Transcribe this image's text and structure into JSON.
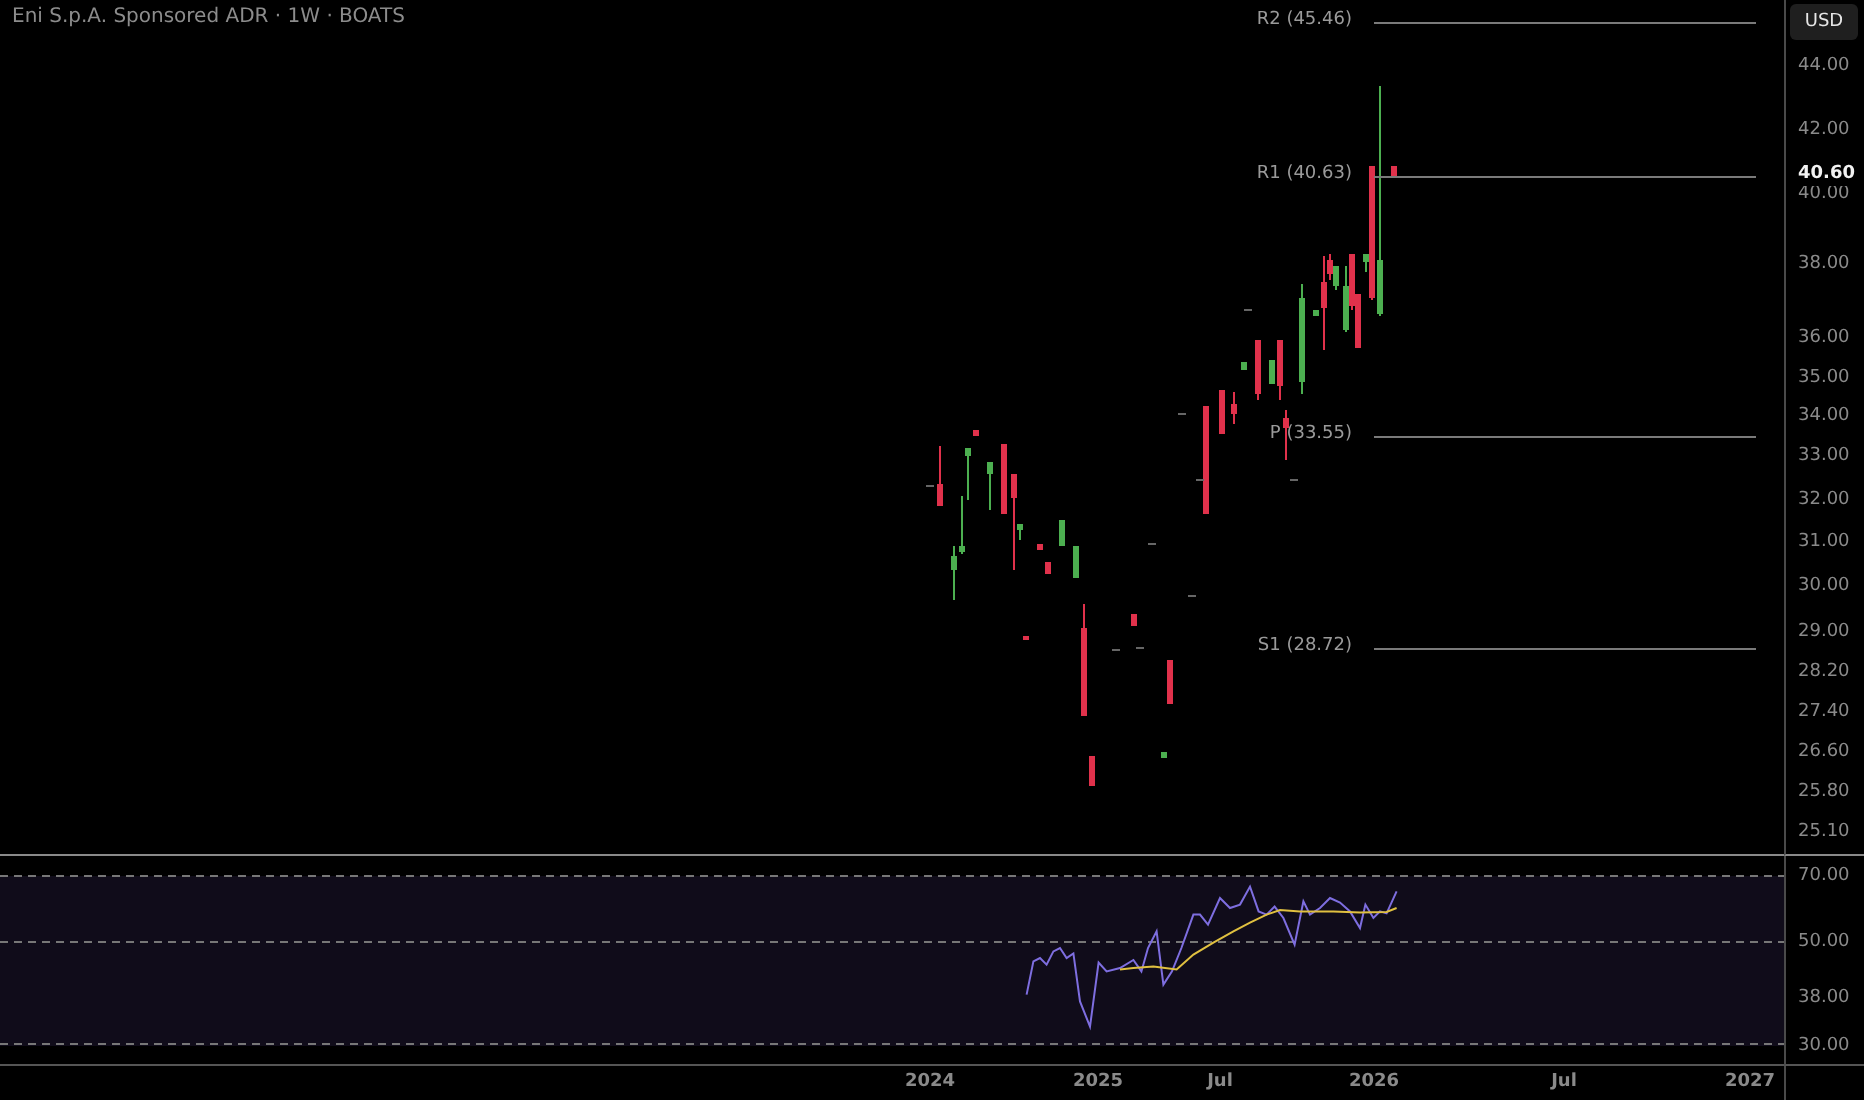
{
  "title": "Eni S.p.A. Sponsored ADR · 1W · BOATS",
  "currency": "USD",
  "pivots": [
    {
      "label": "R2 (45.46)"
    },
    {
      "label": "R1 (40.63)"
    },
    {
      "label": "P (33.55)"
    },
    {
      "label": "S1 (28.72)"
    }
  ],
  "price_axis": {
    "ticks": [
      "44.00",
      "42.00",
      "40.00",
      "38.00",
      "36.00",
      "35.00",
      "34.00",
      "33.00",
      "32.00",
      "31.00",
      "30.00",
      "29.00",
      "28.20",
      "27.40",
      "26.60",
      "25.80",
      "25.10"
    ],
    "last_price": "40.60"
  },
  "rsi_axis": {
    "ticks": [
      "70.00",
      "50.00",
      "38.00",
      "30.00"
    ]
  },
  "time_axis": {
    "labels": [
      "2024",
      "2025",
      "Jul",
      "2026",
      "Jul",
      "2027"
    ]
  }
}
